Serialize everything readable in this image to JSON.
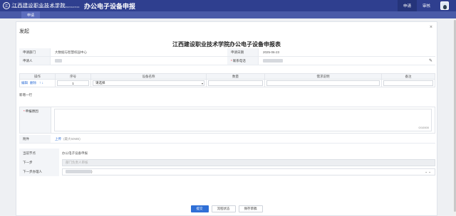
{
  "header": {
    "logo_seal": "江",
    "logo_cn": "江西建设职业技术学院",
    "logo_en": "JIANGXI VOCATIONAL AND TECHNICAL COLLEGE OF CONSTRUCTION",
    "system_name": "办公电子设备申报",
    "nav": [
      "申请",
      "审核"
    ]
  },
  "tabs": [
    {
      "label": "申请"
    }
  ],
  "dialog": {
    "title": "发起",
    "close": "×",
    "form_title": "江西建设职业技术学院办公电子设备申报表",
    "info": {
      "dept_label": "申请部门",
      "dept_value": "大数据与智慧校园中心",
      "date_label": "申请日期",
      "date_value": "2025-06-23",
      "applicant_label": "申请人",
      "contact_label": "联系电话"
    },
    "grid": {
      "headers": [
        "操作",
        "序号",
        "设备名称",
        "数量",
        "需求说明",
        "备注"
      ],
      "row": {
        "op_edit": "编辑",
        "op_delete": "删除",
        "arrow_up": "↑",
        "arrow_down": "↓",
        "seq": "1",
        "device": "请选择"
      },
      "add_row": "新增一行"
    },
    "reason": {
      "label": "申报原因",
      "counter": "0/10000"
    },
    "attach": {
      "label": "附件",
      "upload": "上传",
      "hint": "(最大50MB)"
    },
    "flow": {
      "current_label": "当前节点",
      "current_value": "办公电子设备申报",
      "next_label": "下一步",
      "next_value": "部门负责人审核",
      "handler_label": "下一步办理人",
      "handler_suffix": ")"
    },
    "buttons": [
      "提交",
      "流程状态",
      "保存草稿"
    ]
  }
}
